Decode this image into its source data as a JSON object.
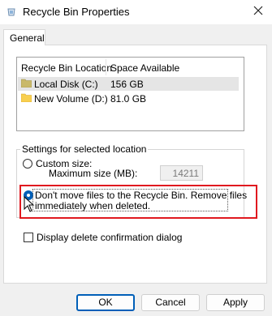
{
  "window": {
    "title": "Recycle Bin Properties"
  },
  "tabs": [
    {
      "label": "General"
    }
  ],
  "list": {
    "columns": [
      "Recycle Bin Location",
      "Space Available"
    ],
    "rows": [
      {
        "location": "Local Disk (C:)",
        "space": "156 GB"
      },
      {
        "location": "New Volume (D:)",
        "space": "81.0 GB"
      }
    ]
  },
  "settings": {
    "group_title": "Settings for selected location",
    "custom_size_label": "Custom size:",
    "max_size_label": "Maximum size (MB):",
    "max_size_value": "14211",
    "dont_move_line1": "Don't move files to the Recycle Bin. Remove files",
    "dont_move_line2": "immediately when deleted.",
    "confirm_label": "Display delete confirmation dialog"
  },
  "buttons": {
    "ok": "OK",
    "cancel": "Cancel",
    "apply": "Apply"
  },
  "colors": {
    "accent": "#005fb8",
    "highlight_border": "#e0191f"
  }
}
